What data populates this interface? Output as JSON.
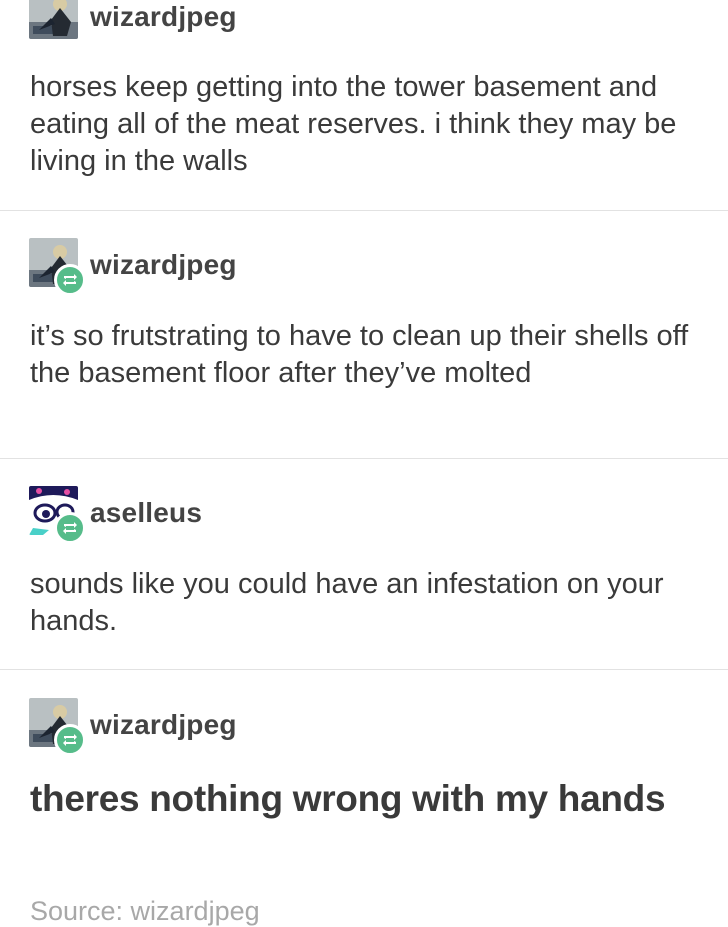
{
  "posts": [
    {
      "username": "wizardjpeg",
      "reblogged": false,
      "text": "horses keep getting into the tower basement and eating all of the meat reserves. i think they may be living in the walls"
    },
    {
      "username": "wizardjpeg",
      "reblogged": true,
      "text": "it’s so frutstrating to have to clean up their shells off the basement floor after they’ve molted"
    },
    {
      "username": "aselleus",
      "reblogged": true,
      "text": "sounds like you could have an infestation on your hands."
    },
    {
      "username": "wizardjpeg",
      "reblogged": true,
      "text": "theres nothing wrong with my hands"
    }
  ],
  "source": {
    "label": "Source: wizardjpeg"
  },
  "colors": {
    "reblog_badge": "#56bc8a",
    "text": "#3a3a3a",
    "source": "#a8a8a8",
    "divider": "#e2e2e2"
  }
}
